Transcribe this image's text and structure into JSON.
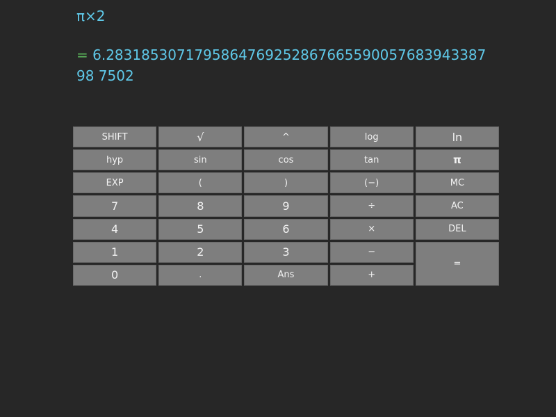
{
  "display": {
    "expression": "π×2",
    "result_prefix": "= ",
    "result_value": "6.283185307179586476925286766559005768394338798 7502"
  },
  "keys": [
    {
      "label": "SHIFT",
      "name": "shift-key",
      "cls": ""
    },
    {
      "label": "√",
      "name": "sqrt-key",
      "cls": "big"
    },
    {
      "label": "^",
      "name": "power-key",
      "cls": ""
    },
    {
      "label": "log",
      "name": "log-key",
      "cls": ""
    },
    {
      "label": "ln",
      "name": "ln-key",
      "cls": "big"
    },
    {
      "label": "hyp",
      "name": "hyp-key",
      "cls": ""
    },
    {
      "label": "sin",
      "name": "sin-key",
      "cls": ""
    },
    {
      "label": "cos",
      "name": "cos-key",
      "cls": ""
    },
    {
      "label": "tan",
      "name": "tan-key",
      "cls": ""
    },
    {
      "label": "π",
      "name": "pi-key",
      "cls": "bold"
    },
    {
      "label": "EXP",
      "name": "exp-key",
      "cls": ""
    },
    {
      "label": "(",
      "name": "open-paren-key",
      "cls": ""
    },
    {
      "label": ")",
      "name": "close-paren-key",
      "cls": ""
    },
    {
      "label": "(−)",
      "name": "negate-key",
      "cls": ""
    },
    {
      "label": "MC",
      "name": "memory-clear-key",
      "cls": ""
    },
    {
      "label": "7",
      "name": "digit-7-key",
      "cls": "big"
    },
    {
      "label": "8",
      "name": "digit-8-key",
      "cls": "big"
    },
    {
      "label": "9",
      "name": "digit-9-key",
      "cls": "big"
    },
    {
      "label": "÷",
      "name": "divide-key",
      "cls": ""
    },
    {
      "label": "AC",
      "name": "all-clear-key",
      "cls": ""
    },
    {
      "label": "4",
      "name": "digit-4-key",
      "cls": "big"
    },
    {
      "label": "5",
      "name": "digit-5-key",
      "cls": "big"
    },
    {
      "label": "6",
      "name": "digit-6-key",
      "cls": "big"
    },
    {
      "label": "×",
      "name": "multiply-key",
      "cls": ""
    },
    {
      "label": "DEL",
      "name": "delete-key",
      "cls": ""
    },
    {
      "label": "1",
      "name": "digit-1-key",
      "cls": "big"
    },
    {
      "label": "2",
      "name": "digit-2-key",
      "cls": "big"
    },
    {
      "label": "3",
      "name": "digit-3-key",
      "cls": "big"
    },
    {
      "label": "−",
      "name": "subtract-key",
      "cls": ""
    },
    {
      "label": "0",
      "name": "digit-0-key",
      "cls": "big"
    },
    {
      "label": ".",
      "name": "decimal-key",
      "cls": ""
    },
    {
      "label": "Ans",
      "name": "ans-key",
      "cls": ""
    },
    {
      "label": "+",
      "name": "add-key",
      "cls": ""
    },
    {
      "label": "=",
      "name": "equals-key",
      "cls": "eq"
    }
  ]
}
